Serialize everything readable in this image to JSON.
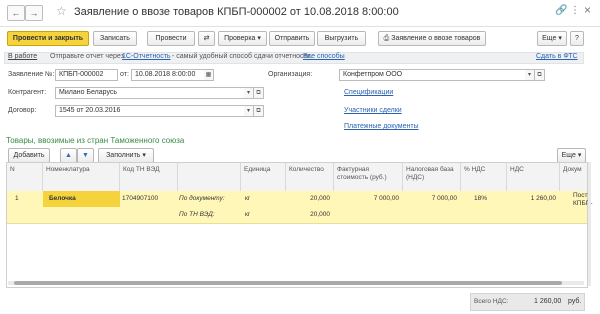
{
  "window": {
    "title": "Заявление о ввозе товаров КПБП-000002 от 10.08.2018 8:00:00",
    "back_icon": "←",
    "forward_icon": "→",
    "star_icon": "☆",
    "link_icon": "🔗",
    "menu_icon": "⋮",
    "close_icon": "×"
  },
  "toolbar": {
    "post_close": "Провести и закрыть",
    "save": "Записать",
    "post": "Провести",
    "check": "Проверка",
    "send": "Отправить",
    "upload": "Выгрузить",
    "print_app": "Заявление о ввозе товаров",
    "more": "Еще",
    "help": "?"
  },
  "infobar": {
    "status": "В работе",
    "text_before": "Отправьте отчет через",
    "service_link": "1С-Отчетность",
    "text_after": "- самый удобный способ сдачи отчетности.",
    "all_methods": "Все способы",
    "submit_fts": "Сдать в ФТС"
  },
  "form": {
    "number_label": "Заявление №:",
    "number_value": "КПБП-000002",
    "date_label": "от:",
    "date_value": "10.08.2018  8:00:00",
    "org_label": "Организация:",
    "org_value": "Конфетпром ООО",
    "contractor_label": "Контрагент:",
    "contractor_value": "Милано Беларусь",
    "contract_label": "Договор:",
    "contract_value": "1545 от 20.03.2016",
    "links": [
      "Спецификации",
      "Участники сделки",
      "Платежные документы"
    ]
  },
  "goods": {
    "section_title": "Товары, ввозимые из стран Таможенного союза",
    "add_button": "Добавить",
    "fill_button": "Заполнить",
    "more_button": "Еще",
    "columns": [
      "N",
      "Номенклатура",
      "Код ТН ВЭД",
      "",
      "Единица",
      "Количество",
      "Фактурная стоимость (руб.)",
      "Налоговая база (НДС)",
      "% НДС",
      "НДС",
      "Докум"
    ],
    "rows": [
      {
        "n": "1",
        "name": "Белочка",
        "code": "1704907100",
        "basis1": "По документу:",
        "unit1": "кг",
        "qty1": "20,000",
        "invoice_value": "7 000,00",
        "tax_base": "7 000,00",
        "vat_rate": "18%",
        "vat": "1 260,00",
        "doc": "Посту",
        "doc2": "КПБП-",
        "basis2": "По ТН ВЭД:",
        "unit2": "кг",
        "qty2": "20,000"
      }
    ]
  },
  "footer": {
    "total_vat_label": "Всего НДС:",
    "total_vat_value": "1 260,00",
    "currency": "руб."
  }
}
